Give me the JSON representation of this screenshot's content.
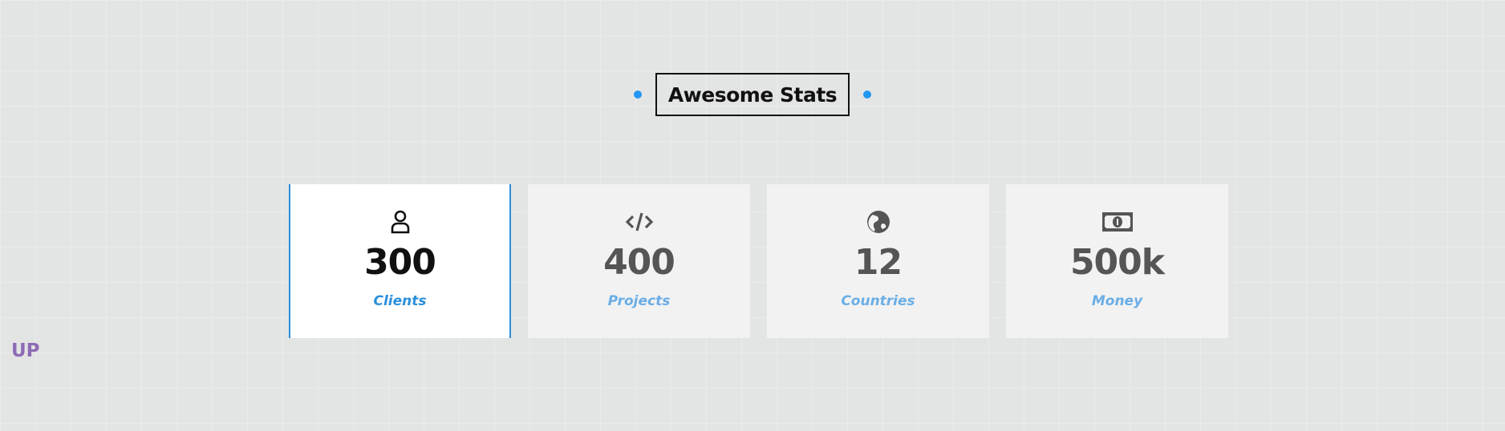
{
  "section": {
    "title": "Awesome Stats",
    "accent": "#2196f3"
  },
  "stats": [
    {
      "icon": "user-icon",
      "value": "300",
      "label": "Clients",
      "active": true
    },
    {
      "icon": "code-icon",
      "value": "400",
      "label": "Projects",
      "active": false
    },
    {
      "icon": "globe-icon",
      "value": "12",
      "label": "Countries",
      "active": false
    },
    {
      "icon": "money-bill-icon",
      "value": "500k",
      "label": "Money",
      "active": false
    }
  ],
  "scroll_up": {
    "label": "UP",
    "color": "#8e6bb5"
  }
}
